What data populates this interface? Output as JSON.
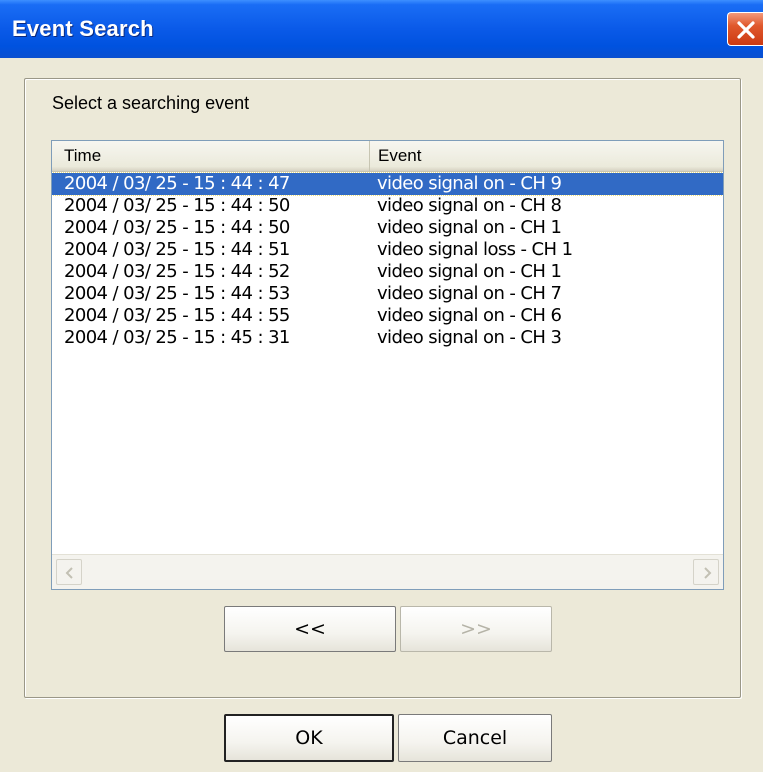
{
  "window": {
    "title": "Event Search"
  },
  "group": {
    "label": "Select a searching event"
  },
  "table": {
    "columns": [
      "Time",
      "Event"
    ],
    "rows": [
      {
        "time": "2004 / 03/ 25 - 15 : 44 : 47",
        "event": "video signal on - CH 9",
        "selected": true
      },
      {
        "time": "2004 / 03/ 25 - 15 : 44 : 50",
        "event": "video signal on - CH 8"
      },
      {
        "time": "2004 / 03/ 25 - 15 : 44 : 50",
        "event": "video signal on - CH 1"
      },
      {
        "time": "2004 / 03/ 25 - 15 : 44 : 51",
        "event": "video signal loss - CH 1"
      },
      {
        "time": "2004 / 03/ 25 - 15 : 44 : 52",
        "event": "video signal on - CH 1"
      },
      {
        "time": "2004 / 03/ 25 - 15 : 44 : 53",
        "event": "video signal on - CH 7"
      },
      {
        "time": "2004 / 03/ 25 - 15 : 44 : 55",
        "event": "video signal on - CH 6"
      },
      {
        "time": "2004 / 03/ 25 - 15 : 45 : 31",
        "event": "video signal on - CH 3"
      }
    ]
  },
  "navigation": {
    "prev_label": "<<",
    "next_label": ">>",
    "next_enabled": false
  },
  "buttons": {
    "ok_label": "OK",
    "cancel_label": "Cancel"
  },
  "colors": {
    "titlebar": "#0a5ae8",
    "selection": "#316ac5",
    "dialog_background": "#ece9d8",
    "close_button": "#e0582c"
  },
  "icons": {
    "close": "close-icon",
    "scroll_left": "chevron-left-icon",
    "scroll_right": "chevron-right-icon"
  }
}
